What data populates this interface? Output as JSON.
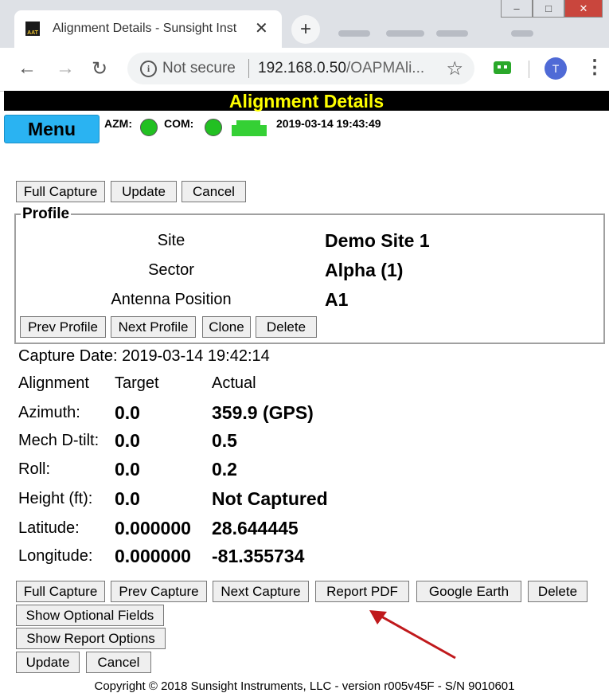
{
  "browser": {
    "tab_title": "Alignment Details - Sunsight Inst",
    "favicon_text": "AAT",
    "close_glyph": "✕",
    "newtab_glyph": "+",
    "not_secure": "Not secure",
    "url_host": "192.168.0.50",
    "url_path": "/OAPMAli...",
    "profile_initial": "T",
    "window_buttons": [
      "–",
      "□",
      "✕"
    ]
  },
  "page": {
    "title": "Alignment Details",
    "menu_label": "Menu",
    "status": {
      "azm_label": "AZM:",
      "com_label": "COM:",
      "datetime": "2019-03-14 19:43:49",
      "azm_color": "#22c022",
      "com_color": "#22c022"
    },
    "top_buttons": [
      "Full Capture",
      "Update",
      "Cancel"
    ],
    "profile": {
      "legend": "Profile",
      "fields": [
        {
          "label": "Site",
          "value": "Demo Site 1"
        },
        {
          "label": "Sector",
          "value": "Alpha (1)"
        },
        {
          "label": "Antenna Position",
          "value": "A1"
        }
      ],
      "buttons": [
        "Prev Profile",
        "Next Profile",
        "Clone",
        "Delete"
      ]
    },
    "capture_date": "Capture Date: 2019-03-14 19:42:14",
    "alignment": {
      "headers": [
        "Alignment",
        "Target",
        "Actual"
      ],
      "rows": [
        {
          "label": "Azimuth:",
          "target": "0.0",
          "actual": "359.9 (GPS)"
        },
        {
          "label": "Mech D-tilt:",
          "target": "0.0",
          "actual": "0.5"
        },
        {
          "label": "Roll:",
          "target": "0.0",
          "actual": "0.2"
        },
        {
          "label": "Height (ft):",
          "target": "0.0",
          "actual": "Not Captured"
        },
        {
          "label": "Latitude:",
          "target": "0.000000",
          "actual": "28.644445"
        },
        {
          "label": "Longitude:",
          "target": "0.000000",
          "actual": "-81.355734"
        }
      ]
    },
    "bottom_buttons": [
      "Full Capture",
      "Prev Capture",
      "Next Capture",
      "Report PDF",
      "Google Earth",
      "Delete"
    ],
    "optional_fields_button": "Show Optional Fields",
    "report_options_button": "Show Report Options",
    "final_buttons": [
      "Update",
      "Cancel"
    ],
    "copyright": "Copyright © 2018 Sunsight Instruments, LLC - version r005v45F - S/N 9010601",
    "annotation_color": "#c0191c"
  }
}
